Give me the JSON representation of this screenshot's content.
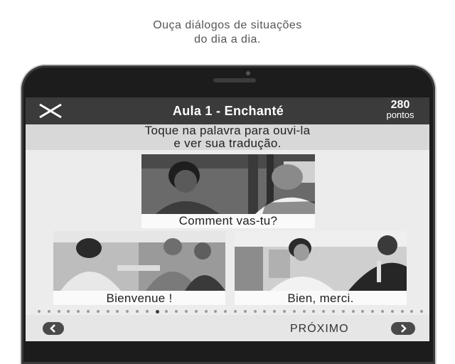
{
  "promo": {
    "line1": "Ouça diálogos de situações",
    "line2": "do dia a dia."
  },
  "header": {
    "title": "Aula 1 - Enchanté",
    "points_value": "280",
    "points_label": "pontos",
    "close_icon": "close-x"
  },
  "instruction": {
    "line1": "Toque na palavra para ouvi-la",
    "line2": "e ver sua tradução."
  },
  "cards": [
    {
      "caption": "Comment vas-tu?"
    },
    {
      "caption": "Bienvenue !"
    },
    {
      "caption": "Bien, merci."
    }
  ],
  "pager": {
    "current": 12,
    "total": 40
  },
  "footer": {
    "back_icon": "chevron-left",
    "next_label": "PRÓXIMO",
    "next_icon": "chevron-right"
  },
  "colors": {
    "appbar": "#3b3b3b",
    "instruction_bg": "#d8d8d8",
    "screen_bg": "#ececec"
  }
}
